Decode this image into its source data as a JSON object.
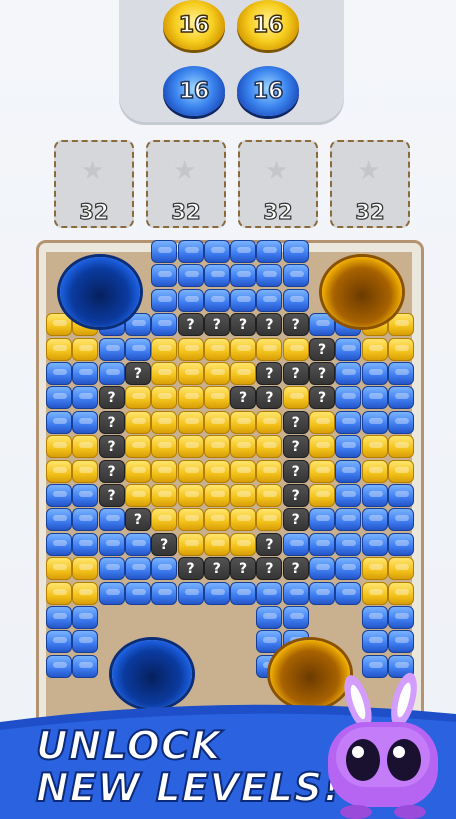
{
  "coins": {
    "yellow": [
      "16",
      "16"
    ],
    "blue": [
      "16",
      "16"
    ]
  },
  "slots": [
    "32",
    "32",
    "32",
    "32"
  ],
  "colors": {
    "yellow": "#f3c21a",
    "blue": "#3d7cf0",
    "mystery": "#353535",
    "banner": "#2a62e0"
  },
  "mystery_glyph": "?",
  "grid": {
    "rows": [
      "....BBBBBB....",
      "....BBBBBB....",
      "....BBBBBB....",
      "YYBBBQQQQQBBYY",
      "YYBBYYYYYYQBYY",
      "BBBQYYYYQQQBBB",
      "BBQYYYYQQYQBBB",
      "BBQYYYYYYQYBBB",
      "YYQYYYYYYQYBYY",
      "YYQYYYYYYQYBYY",
      "BBQYYYYYYQYBBB",
      "BBBQYYYYYQBBBB",
      "BBBBQYYYQBBBBB",
      "YYBBBQQQQQBBYY",
      "YYBBBBBBBBBBYY",
      "BB......BB..BB",
      "BB......BB..BB",
      "BB......BB..BB"
    ]
  },
  "promo": {
    "line1": "UNLOCK",
    "line2": "NEW LEVELS!"
  }
}
